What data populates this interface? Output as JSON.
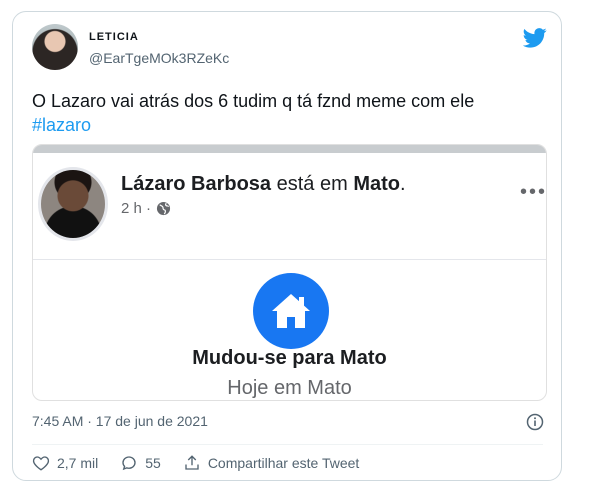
{
  "user": {
    "display_name": "LETICIA",
    "handle": "@EarTgeMOk3RZeKc"
  },
  "tweet": {
    "text": "O Lazaro vai atrás dos 6 tudim q tá fznd meme com ele",
    "hashtag": "#lazaro",
    "timestamp": "7:45 AM · 17 de jun de 2021"
  },
  "embedded_post": {
    "name": "Lázaro Barbosa",
    "verb": " está em ",
    "place": "Mato",
    "period": ".",
    "time": "2 h ·",
    "life_event_title": "Mudou-se para Mato",
    "life_event_sub": "Hoje em Mato",
    "more": "•••"
  },
  "actions": {
    "likes": "2,7 mil",
    "replies": "55",
    "share_label": "Compartilhar este Tweet"
  },
  "colors": {
    "twitter_blue": "#1d9bf0",
    "facebook_blue": "#1877f2"
  }
}
